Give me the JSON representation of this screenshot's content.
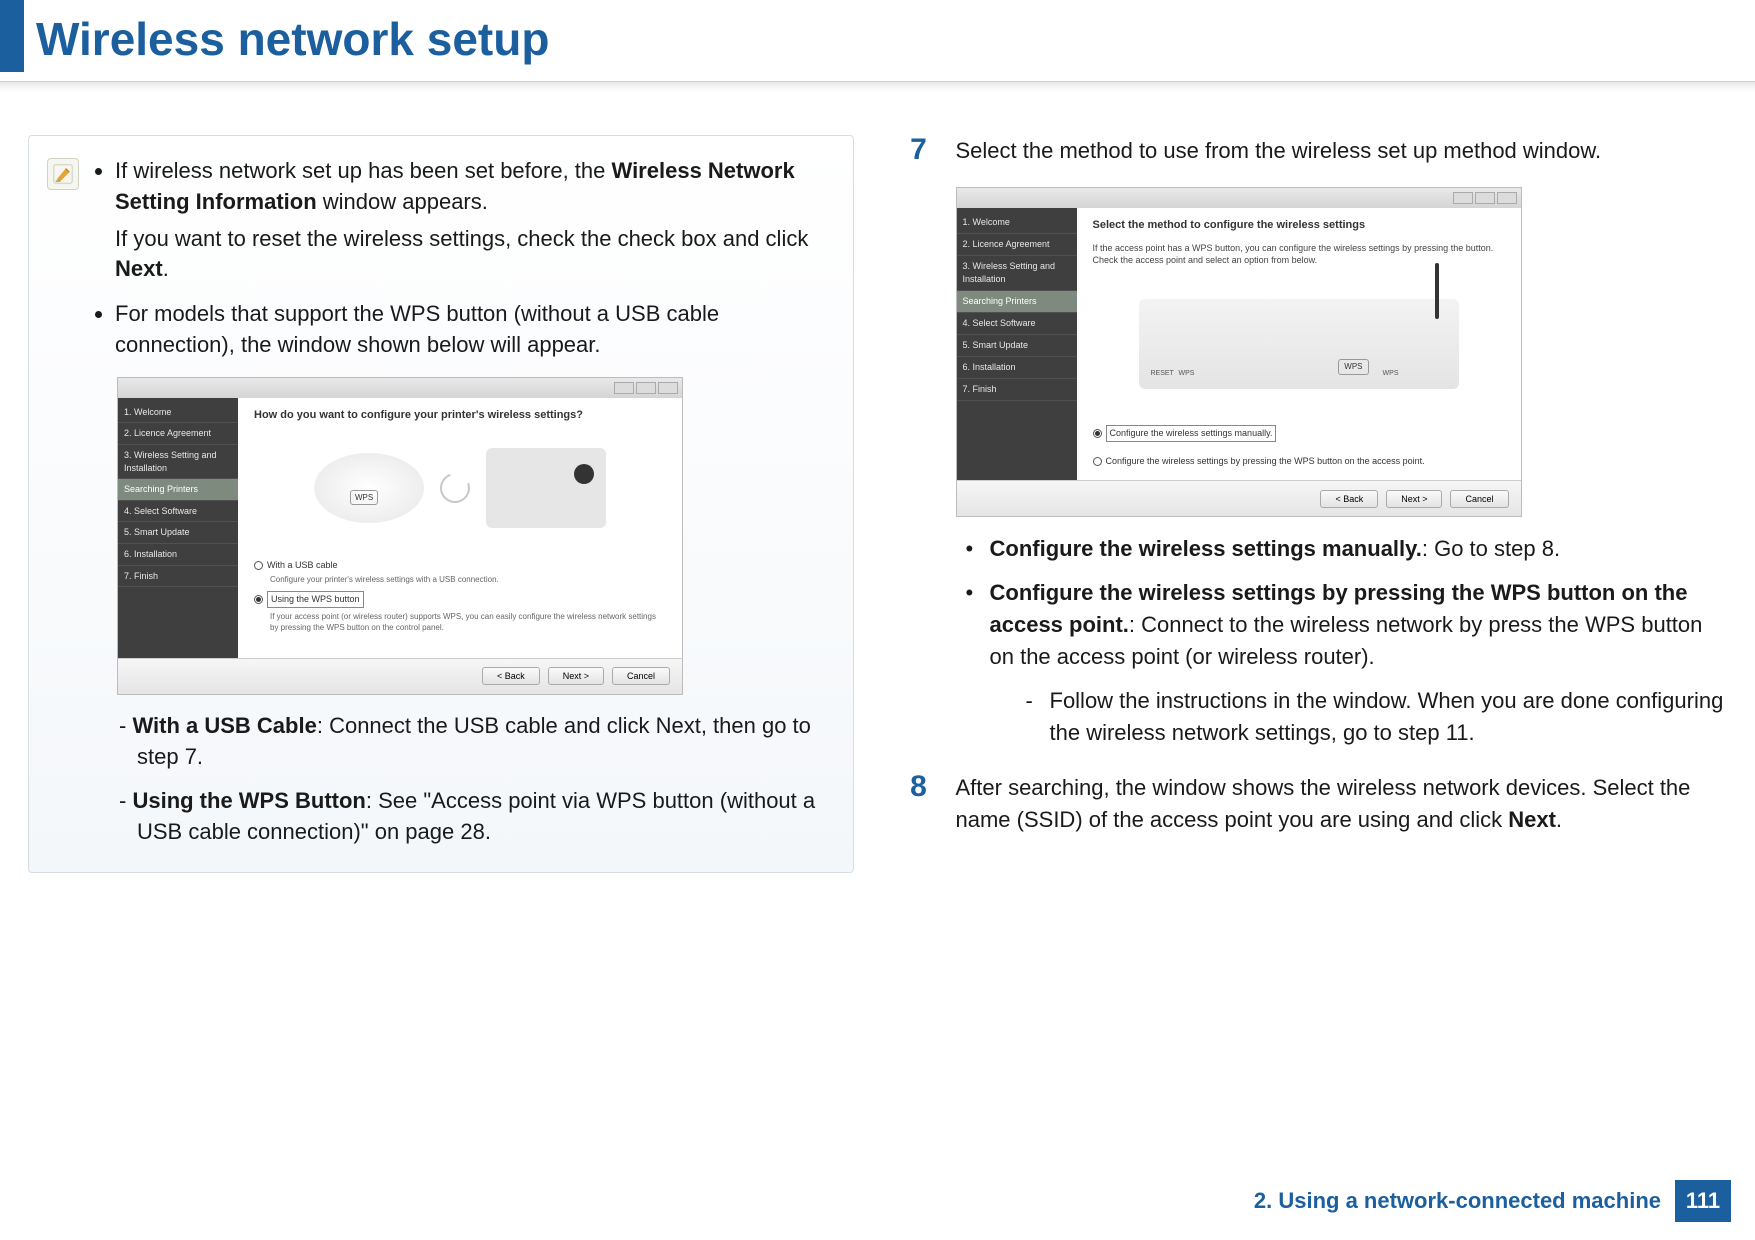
{
  "page": {
    "title": "Wireless network setup",
    "footer_chapter": "2. Using a network-connected machine",
    "page_number": "111"
  },
  "note": {
    "b1_prefix": "If wireless network set up has been set before, the ",
    "b1_bold": "Wireless Network Setting Information",
    "b1_suffix": " window appears.",
    "b1_line2_prefix": "If you want to reset the wireless settings, check the check box and click ",
    "b1_line2_bold": "Next",
    "b1_line2_suffix": ".",
    "b2": "For models that support the WPS button (without a USB cable connection), the window shown below will appear.",
    "sub": {
      "s1_bold": "With a USB Cable",
      "s1_text": ": Connect the USB cable and click Next, then go to step 7.",
      "s2_bold": "Using the WPS Button",
      "s2_text": ": See \"Access point via WPS button (without a USB cable connection)\" on page 28."
    }
  },
  "wizard1": {
    "heading": "How do you want to configure your printer's wireless settings?",
    "side": [
      "1. Welcome",
      "2. Licence Agreement",
      "3. Wireless Setting and Installation",
      "Searching Printers",
      "4. Select Software",
      "5. Smart Update",
      "6. Installation",
      "7. Finish"
    ],
    "opt1": {
      "label": "With a USB cable",
      "hint": "Configure your printer's wireless settings with a USB connection."
    },
    "opt2": {
      "label": "Using the WPS button",
      "hint": "If your access point (or wireless router) supports WPS, you can easily configure the wireless network settings by pressing the WPS button on the control panel."
    },
    "buttons": {
      "back": "< Back",
      "next": "Next >",
      "cancel": "Cancel"
    },
    "wps_label": "WPS"
  },
  "wizard2": {
    "heading": "Select the method to configure the wireless settings",
    "desc": "If the access point has a WPS button, you can configure the wireless settings by pressing the button. Check the access point and select an option from below.",
    "side": [
      "1. Welcome",
      "2. Licence Agreement",
      "3. Wireless Setting and Installation",
      "Searching Printers",
      "4. Select Software",
      "5. Smart Update",
      "6. Installation",
      "7. Finish"
    ],
    "opt1": {
      "label": "Configure the wireless settings manually."
    },
    "opt2": {
      "label": "Configure the wireless settings by pressing the WPS button on the access point."
    },
    "buttons": {
      "back": "< Back",
      "next": "Next >",
      "cancel": "Cancel"
    },
    "wps_label": "WPS",
    "reset_label": "RESET"
  },
  "steps": {
    "s7": {
      "num": "7",
      "intro": "Select the method to use from the wireless set up method window.",
      "b1_bold": "Configure the wireless settings manually.",
      "b1_text": ": Go to step 8.",
      "b2_bold": "Configure the wireless settings by pressing the WPS button on the access point.",
      "b2_text": ": Connect to the wireless network by press the WPS button on the access point (or wireless router).",
      "b2_dash": "Follow the instructions in the window. When you are done configuring the wireless network settings, go to step 11."
    },
    "s8": {
      "num": "8",
      "text_prefix": "After searching, the window shows the wireless network devices. Select the name (SSID) of the access point you are using and click ",
      "text_bold": "Next",
      "text_suffix": "."
    }
  }
}
